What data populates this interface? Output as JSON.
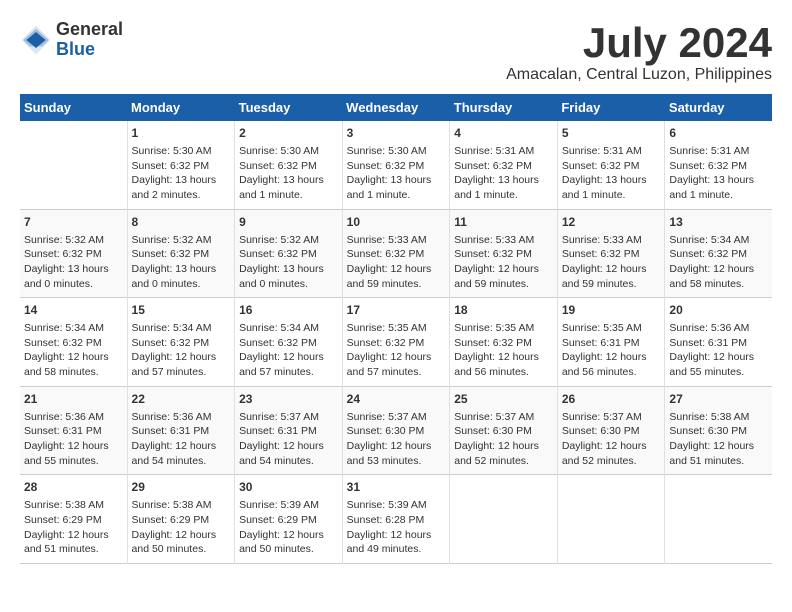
{
  "header": {
    "logo_general": "General",
    "logo_blue": "Blue",
    "title": "July 2024",
    "subtitle": "Amacalan, Central Luzon, Philippines"
  },
  "calendar": {
    "days_of_week": [
      "Sunday",
      "Monday",
      "Tuesday",
      "Wednesday",
      "Thursday",
      "Friday",
      "Saturday"
    ],
    "weeks": [
      [
        {
          "day": "",
          "info": ""
        },
        {
          "day": "1",
          "info": "Sunrise: 5:30 AM\nSunset: 6:32 PM\nDaylight: 13 hours\nand 2 minutes."
        },
        {
          "day": "2",
          "info": "Sunrise: 5:30 AM\nSunset: 6:32 PM\nDaylight: 13 hours\nand 1 minute."
        },
        {
          "day": "3",
          "info": "Sunrise: 5:30 AM\nSunset: 6:32 PM\nDaylight: 13 hours\nand 1 minute."
        },
        {
          "day": "4",
          "info": "Sunrise: 5:31 AM\nSunset: 6:32 PM\nDaylight: 13 hours\nand 1 minute."
        },
        {
          "day": "5",
          "info": "Sunrise: 5:31 AM\nSunset: 6:32 PM\nDaylight: 13 hours\nand 1 minute."
        },
        {
          "day": "6",
          "info": "Sunrise: 5:31 AM\nSunset: 6:32 PM\nDaylight: 13 hours\nand 1 minute."
        }
      ],
      [
        {
          "day": "7",
          "info": "Sunrise: 5:32 AM\nSunset: 6:32 PM\nDaylight: 13 hours\nand 0 minutes."
        },
        {
          "day": "8",
          "info": "Sunrise: 5:32 AM\nSunset: 6:32 PM\nDaylight: 13 hours\nand 0 minutes."
        },
        {
          "day": "9",
          "info": "Sunrise: 5:32 AM\nSunset: 6:32 PM\nDaylight: 13 hours\nand 0 minutes."
        },
        {
          "day": "10",
          "info": "Sunrise: 5:33 AM\nSunset: 6:32 PM\nDaylight: 12 hours\nand 59 minutes."
        },
        {
          "day": "11",
          "info": "Sunrise: 5:33 AM\nSunset: 6:32 PM\nDaylight: 12 hours\nand 59 minutes."
        },
        {
          "day": "12",
          "info": "Sunrise: 5:33 AM\nSunset: 6:32 PM\nDaylight: 12 hours\nand 59 minutes."
        },
        {
          "day": "13",
          "info": "Sunrise: 5:34 AM\nSunset: 6:32 PM\nDaylight: 12 hours\nand 58 minutes."
        }
      ],
      [
        {
          "day": "14",
          "info": "Sunrise: 5:34 AM\nSunset: 6:32 PM\nDaylight: 12 hours\nand 58 minutes."
        },
        {
          "day": "15",
          "info": "Sunrise: 5:34 AM\nSunset: 6:32 PM\nDaylight: 12 hours\nand 57 minutes."
        },
        {
          "day": "16",
          "info": "Sunrise: 5:34 AM\nSunset: 6:32 PM\nDaylight: 12 hours\nand 57 minutes."
        },
        {
          "day": "17",
          "info": "Sunrise: 5:35 AM\nSunset: 6:32 PM\nDaylight: 12 hours\nand 57 minutes."
        },
        {
          "day": "18",
          "info": "Sunrise: 5:35 AM\nSunset: 6:32 PM\nDaylight: 12 hours\nand 56 minutes."
        },
        {
          "day": "19",
          "info": "Sunrise: 5:35 AM\nSunset: 6:31 PM\nDaylight: 12 hours\nand 56 minutes."
        },
        {
          "day": "20",
          "info": "Sunrise: 5:36 AM\nSunset: 6:31 PM\nDaylight: 12 hours\nand 55 minutes."
        }
      ],
      [
        {
          "day": "21",
          "info": "Sunrise: 5:36 AM\nSunset: 6:31 PM\nDaylight: 12 hours\nand 55 minutes."
        },
        {
          "day": "22",
          "info": "Sunrise: 5:36 AM\nSunset: 6:31 PM\nDaylight: 12 hours\nand 54 minutes."
        },
        {
          "day": "23",
          "info": "Sunrise: 5:37 AM\nSunset: 6:31 PM\nDaylight: 12 hours\nand 54 minutes."
        },
        {
          "day": "24",
          "info": "Sunrise: 5:37 AM\nSunset: 6:30 PM\nDaylight: 12 hours\nand 53 minutes."
        },
        {
          "day": "25",
          "info": "Sunrise: 5:37 AM\nSunset: 6:30 PM\nDaylight: 12 hours\nand 52 minutes."
        },
        {
          "day": "26",
          "info": "Sunrise: 5:37 AM\nSunset: 6:30 PM\nDaylight: 12 hours\nand 52 minutes."
        },
        {
          "day": "27",
          "info": "Sunrise: 5:38 AM\nSunset: 6:30 PM\nDaylight: 12 hours\nand 51 minutes."
        }
      ],
      [
        {
          "day": "28",
          "info": "Sunrise: 5:38 AM\nSunset: 6:29 PM\nDaylight: 12 hours\nand 51 minutes."
        },
        {
          "day": "29",
          "info": "Sunrise: 5:38 AM\nSunset: 6:29 PM\nDaylight: 12 hours\nand 50 minutes."
        },
        {
          "day": "30",
          "info": "Sunrise: 5:39 AM\nSunset: 6:29 PM\nDaylight: 12 hours\nand 50 minutes."
        },
        {
          "day": "31",
          "info": "Sunrise: 5:39 AM\nSunset: 6:28 PM\nDaylight: 12 hours\nand 49 minutes."
        },
        {
          "day": "",
          "info": ""
        },
        {
          "day": "",
          "info": ""
        },
        {
          "day": "",
          "info": ""
        }
      ]
    ]
  }
}
